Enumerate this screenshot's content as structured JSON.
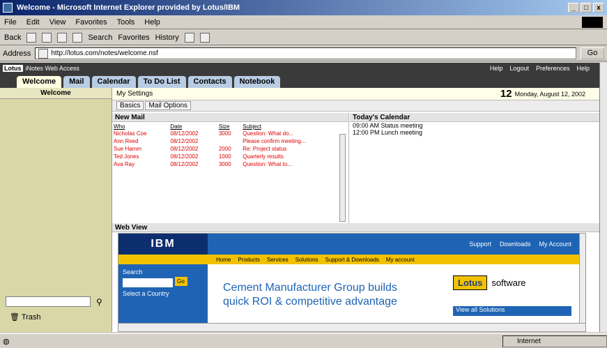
{
  "window": {
    "title": "Welcome - Microsoft Internet Explorer provided by Lotus/IBM"
  },
  "menu": [
    "File",
    "Edit",
    "View",
    "Favorites",
    "Tools",
    "Help"
  ],
  "toolbar": {
    "back": "Back",
    "search": "Search",
    "favorites": "Favorites",
    "history": "History"
  },
  "address": {
    "label": "Address",
    "url": "http://lotus.com/notes/welcome.nsf",
    "go": "Go"
  },
  "lotus": {
    "badge": "Lotus",
    "app": "iNotes Web Access",
    "links": [
      "Help",
      "Logout",
      "Preferences",
      "Help"
    ]
  },
  "tabs": [
    "Welcome",
    "Mail",
    "Calendar",
    "To Do List",
    "Contacts",
    "Notebook"
  ],
  "left": {
    "welcome": "Welcome",
    "trash": "Trash"
  },
  "subbar": {
    "label": "My Settings",
    "date_num": "12",
    "date_text": "Monday, August 12, 2002"
  },
  "wtabs": [
    "Basics",
    "Mail Options"
  ],
  "newmail": {
    "header": "New Mail",
    "columns": [
      "Who",
      "Date",
      "Size",
      "Subject"
    ],
    "rows": [
      {
        "who": "Nicholas Coe",
        "date": "08/12/2002",
        "size": "3000",
        "subject": "Question: What do..."
      },
      {
        "who": "Ann Reed",
        "date": "08/12/2002",
        "size": "",
        "subject": "Please confirm meeting..."
      },
      {
        "who": "Sue Hamm",
        "date": "08/12/2002",
        "size": "2000",
        "subject": "Re: Project status"
      },
      {
        "who": "Ted Jones",
        "date": "08/12/2002",
        "size": "1000",
        "subject": "Quarterly results"
      },
      {
        "who": "Ava Ray",
        "date": "08/12/2002",
        "size": "3000",
        "subject": "Question: What to..."
      }
    ]
  },
  "calendar": {
    "header": "Today's Calendar",
    "items": [
      "09:00 AM Status meeting",
      "12:00 PM Lunch meeting"
    ]
  },
  "webview": {
    "header": "Web View",
    "logo": "IBM",
    "toplinks": [
      "Support",
      "Downloads",
      "My Account"
    ],
    "nav": [
      "Home",
      "Products",
      "Services",
      "Solutions",
      "Support & Downloads",
      "My account"
    ],
    "side_label": "Search",
    "side_go": "Go",
    "side_link": "Select a Country",
    "headline": "Cement Manufacturer Group builds quick ROI & competitive advantage",
    "lotus_box": "Lotus",
    "lotus_text": "software",
    "blue_text": "View all Solutions"
  },
  "status": {
    "zone": "Internet"
  }
}
